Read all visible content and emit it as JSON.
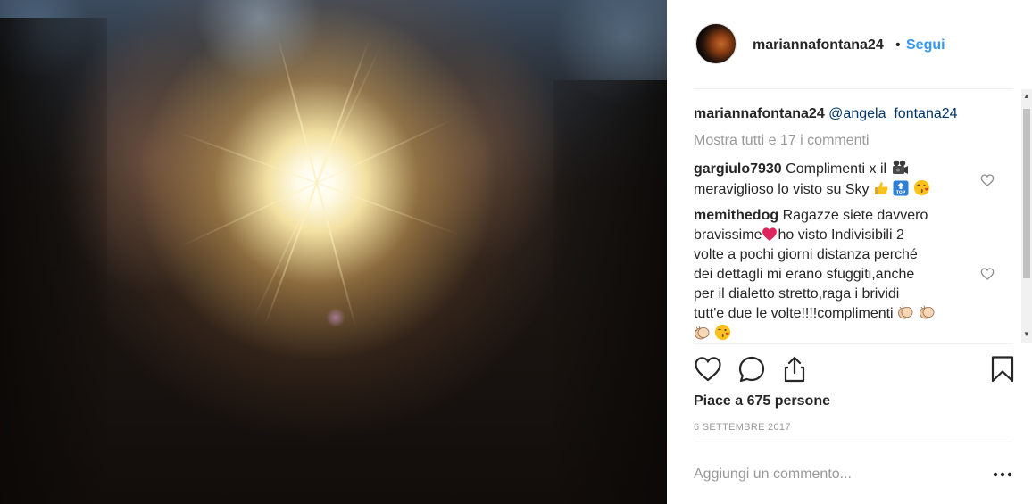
{
  "post": {
    "username": "mariannafontana24",
    "follow_label": "Segui",
    "separator": "•"
  },
  "caption": {
    "username": "mariannafontana24",
    "mention": "@angela_fontana24"
  },
  "show_all_comments": "Mostra tutti e 17 i commenti",
  "comments": [
    {
      "username": "gargiulo7930",
      "line1": "Complimenti x il",
      "line2": "meraviglioso lo visto su Sky",
      "emojis": [
        "movie-camera-icon",
        "thumbs-up-icon",
        "top-arrow-icon",
        "kissing-face-icon"
      ]
    },
    {
      "username": "memithedog",
      "text_a": "Ragazze siete davvero",
      "text_b": "bravissime",
      "text_c": "ho visto Indivisibili 2",
      "lines": [
        "volte a pochi giorni distanza perché",
        "dei dettagli mi erano sfuggiti,anche",
        "per il dialetto stretto,raga i brividi",
        "tutt'e due le volte!!!!complimenti"
      ],
      "emojis": [
        "red-heart-icon",
        "clapping-hands-icon",
        "kissing-face-icon"
      ]
    }
  ],
  "likes_text": "Piace a 675 persone",
  "date": "6 SETTEMBRE 2017",
  "add_comment_placeholder": "Aggiungi un commento...",
  "icons": {
    "like": "heart-outline-icon",
    "comment": "speech-bubble-icon",
    "share": "share-upload-icon",
    "save": "bookmark-icon",
    "more": "ellipsis-icon"
  },
  "colors": {
    "link_blue": "#3897f0",
    "mention_blue": "#003569",
    "text": "#262626",
    "muted": "#999999"
  }
}
